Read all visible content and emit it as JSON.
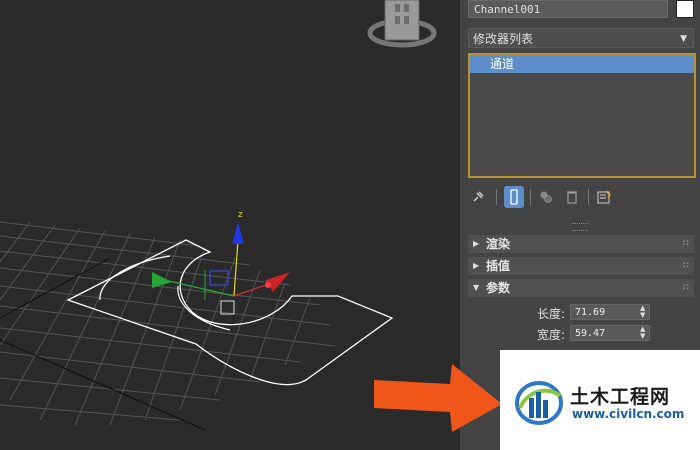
{
  "viewport": {
    "gizmo_axis_label": "z"
  },
  "command_panel": {
    "object_name": "Channel001",
    "object_color": "#ffffff",
    "modifier_list_label": "修改器列表",
    "modifier_stack": [
      {
        "label": "通道",
        "selected": true
      }
    ],
    "toolbar_icons": [
      "pin-icon",
      "show-end-result-icon",
      "make-unique-icon",
      "remove-modifier-icon",
      "configure-modifier-sets-icon"
    ],
    "rollouts": [
      {
        "title": "渲染",
        "expanded": false
      },
      {
        "title": "插值",
        "expanded": false
      },
      {
        "title": "参数",
        "expanded": true
      }
    ],
    "parameters": [
      {
        "label": "长度:",
        "value": "71.69"
      },
      {
        "label": "宽度:",
        "value": "59.47"
      }
    ],
    "selection_color": "#5d8ec9",
    "stack_border_color": "#b8922b"
  },
  "watermark": {
    "title": "土木工程网",
    "url": "www.civilcn.com"
  },
  "annotation_arrow_color": "#f0561a"
}
